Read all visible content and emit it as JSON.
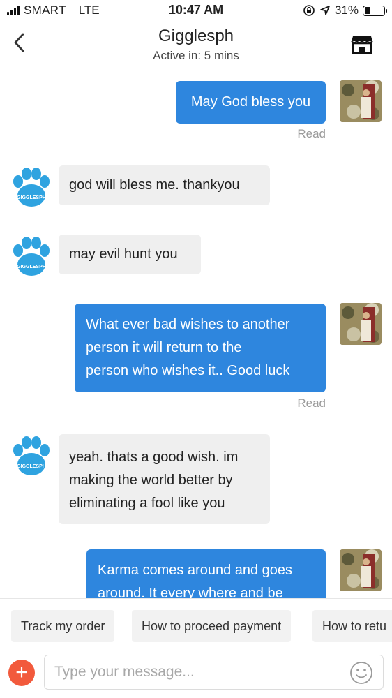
{
  "status_bar": {
    "carrier": "SMART",
    "network": "LTE",
    "time": "10:47 AM",
    "battery": "31%",
    "battery_level": 0.31
  },
  "header": {
    "title": "Gigglesph",
    "subtitle": "Active in: 5 mins"
  },
  "messages": [
    {
      "from": "me",
      "text": "May God bless you",
      "status": "Read"
    },
    {
      "from": "shop",
      "text": "god will bless me. thankyou"
    },
    {
      "from": "shop",
      "text": "may evil hunt you"
    },
    {
      "from": "me",
      "lines": [
        "What ever bad wishes to another",
        "person it will return to the",
        "person who wishes it.. Good luck"
      ],
      "status": "Read"
    },
    {
      "from": "shop",
      "lines": [
        "yeah. thats a good wish. im",
        "making the world better by",
        "eliminating a fool like you"
      ]
    },
    {
      "from": "me",
      "lines": [
        "Karma comes around and goes",
        "around. It every where and be"
      ]
    }
  ],
  "shop_avatar_text": "GIGGLESPH",
  "quick_replies": [
    "Track my order",
    "How to proceed payment",
    "How to retu"
  ],
  "composer": {
    "placeholder": "Type your message...",
    "add_label": "+"
  },
  "colors": {
    "outgoing_bubble": "#2e86de",
    "incoming_bubble": "#efefef",
    "paw": "#2fa3e0",
    "add_button": "#f25a3c"
  }
}
